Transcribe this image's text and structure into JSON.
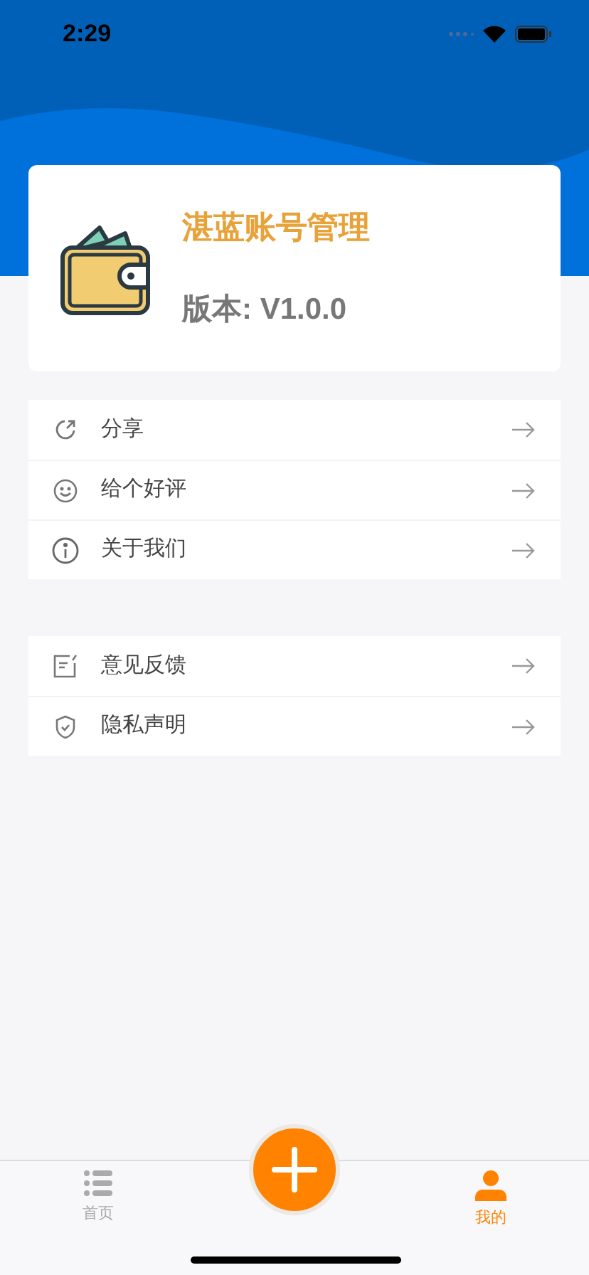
{
  "status_bar": {
    "time": "2:29"
  },
  "app_card": {
    "title": "湛蓝账号管理",
    "version": "版本: V1.0.0"
  },
  "menu_groups": [
    {
      "items": [
        {
          "kind": "share",
          "label": "分享"
        },
        {
          "kind": "rate",
          "label": "给个好评"
        },
        {
          "kind": "about",
          "label": "关于我们"
        }
      ]
    },
    {
      "items": [
        {
          "kind": "feedback",
          "label": "意见反馈"
        },
        {
          "kind": "privacy",
          "label": "隐私声明"
        }
      ]
    }
  ],
  "tab_bar": {
    "tabs": [
      {
        "kind": "list",
        "label": "首页",
        "selected": false
      },
      {
        "kind": "person",
        "label": "我的",
        "selected": true
      }
    ]
  }
}
